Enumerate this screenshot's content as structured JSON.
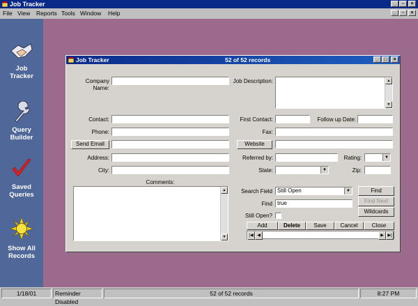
{
  "app": {
    "title": "Job Tracker"
  },
  "menu": [
    "File",
    "View",
    "Reports",
    "Tools",
    "Window",
    "Help"
  ],
  "sidebar": {
    "items": [
      {
        "line1": "Job",
        "line2": "Tracker"
      },
      {
        "line1": "Query",
        "line2": "Builder"
      },
      {
        "line1": "Saved",
        "line2": "Queries"
      },
      {
        "line1": "Show All",
        "line2": "Records"
      }
    ]
  },
  "window": {
    "title": "Job Tracker",
    "record_count": "52 of 52 records"
  },
  "form": {
    "company_name_label": "Company Name:",
    "job_description_label": "Job Description:",
    "contact_label": "Contact:",
    "first_contact_label": "First Contact:",
    "follow_up_label": "Follow up Date:",
    "phone_label": "Phone:",
    "fax_label": "Fax:",
    "send_email_button": "Send Email",
    "website_button": "Website",
    "address_label": "Address:",
    "referred_by_label": "Referred by:",
    "rating_label": "Rating:",
    "city_label": "City:",
    "state_label": "State:",
    "zip_label": "Zip:",
    "comments_label": "Comments:",
    "search_field_label": "Search Field",
    "search_field_value": "Still Open",
    "find_label": "Find",
    "find_value": "true",
    "still_open_label": "Still Open?",
    "find_button": "Find",
    "find_next_button": "Find Next",
    "wildcards_button": "Wildcards",
    "add_button": "Add",
    "delete_button": "Delete",
    "save_button": "Save",
    "cancel_button": "Cancel",
    "close_button": "Close"
  },
  "status": {
    "date": "1/18/01",
    "reminder": "Reminder Disabled",
    "records": "52 of 52 records",
    "time": "8:27 PM"
  },
  "colors": {
    "desktop": "#9c6a8c",
    "sidebar": "#4f6899",
    "title": "#0a2a8a"
  }
}
